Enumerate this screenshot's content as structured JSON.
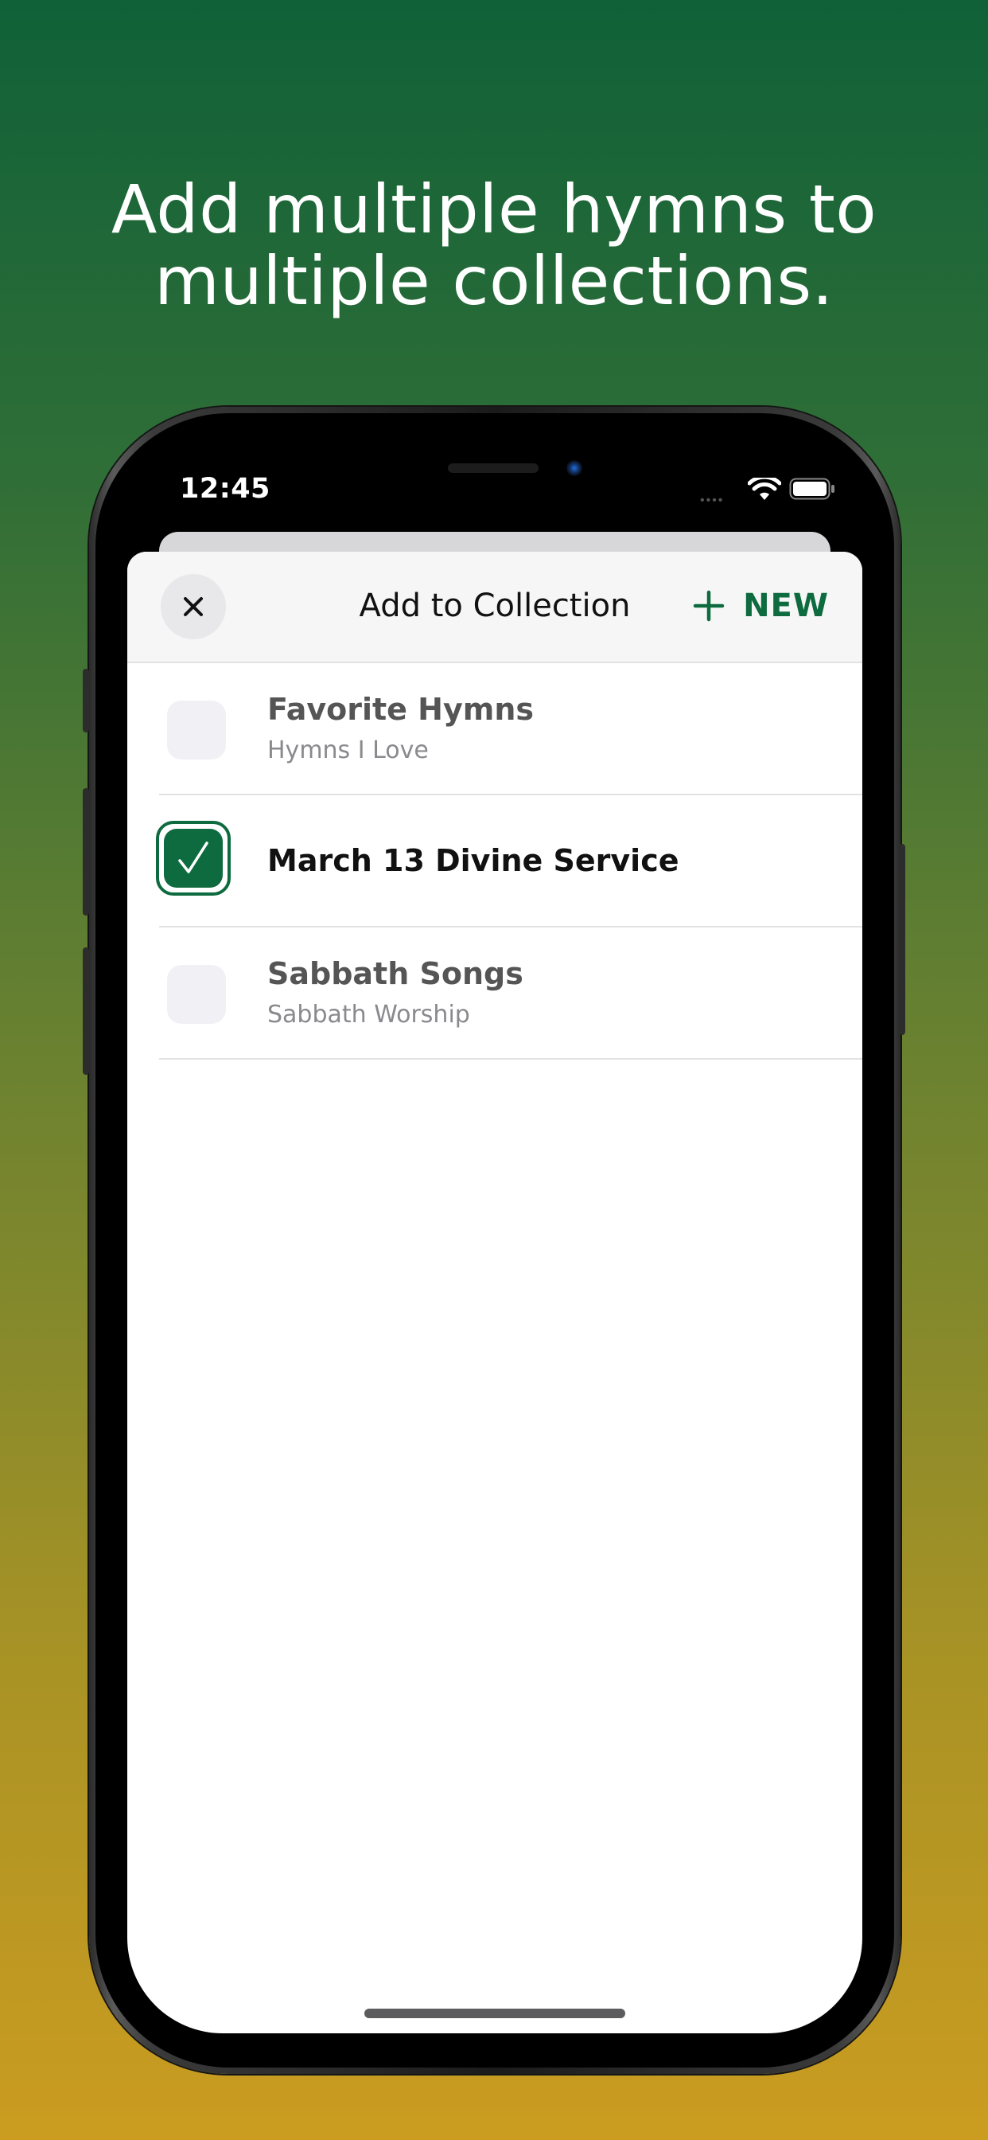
{
  "headline": {
    "line1": "Add multiple hymns to",
    "line2": "multiple collections."
  },
  "status_bar": {
    "time": "12:45"
  },
  "sheet": {
    "title": "Add to Collection",
    "new_label": "NEW"
  },
  "collections": [
    {
      "title": "Favorite Hymns",
      "subtitle": "Hymns I Love",
      "checked": false
    },
    {
      "title": "March 13 Divine Service",
      "subtitle": "",
      "checked": true
    },
    {
      "title": "Sabbath Songs",
      "subtitle": "Sabbath Worship",
      "checked": false
    }
  ],
  "colors": {
    "accent": "#0e6b3f",
    "gradient_top": "#106138",
    "gradient_bottom": "#cb9c20"
  },
  "icons": {
    "close": "close-icon",
    "new": "plus-icon",
    "check": "checkmark-icon",
    "wifi": "wifi-icon",
    "battery": "battery-icon"
  }
}
